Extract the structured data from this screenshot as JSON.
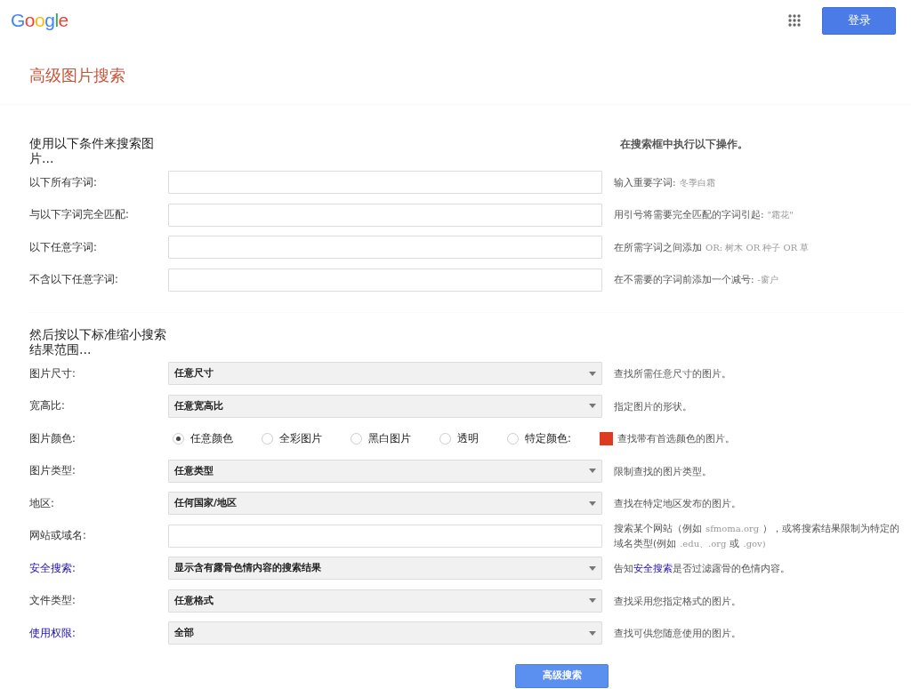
{
  "header": {
    "logo": "Google",
    "signin_button": "登录"
  },
  "page_title": "高级图片搜索",
  "sections": [
    {
      "heading": "使用以下条件来搜索图片...",
      "side_heading": "在搜索框中执行以下操作。",
      "rows": [
        {
          "kind": "input",
          "label": "以下所有字词:",
          "hint": [
            {
              "kind": "text",
              "text": "输入重要字词:"
            },
            {
              "kind": "example",
              "text": "冬季白霜"
            }
          ]
        },
        {
          "kind": "input",
          "label": "与以下字词完全匹配:",
          "hint": [
            {
              "kind": "text",
              "text": "用引号将需要完全匹配的字词引起:"
            },
            {
              "kind": "example",
              "text": "\"霜花\""
            }
          ]
        },
        {
          "kind": "input",
          "label": "以下任意字词:",
          "hint": [
            {
              "kind": "text",
              "text": "在所需字词之间添加"
            },
            {
              "kind": "example",
              "text": "OR: 树木 OR 种子 OR 草"
            }
          ]
        },
        {
          "kind": "input",
          "label": "不含以下任意字词:",
          "hint": [
            {
              "kind": "text",
              "text": "在不需要的字词前添加一个减号:"
            },
            {
              "kind": "example",
              "text": "-窗户"
            }
          ]
        }
      ]
    },
    {
      "heading": "然后按以下标准缩小搜索结果范围...",
      "rows": [
        {
          "kind": "select",
          "label": "图片尺寸:",
          "value": "任意尺寸",
          "hint": [
            {
              "kind": "text",
              "text": "查找所需任意尺寸的图片。"
            }
          ]
        },
        {
          "kind": "select",
          "label": "宽高比:",
          "value": "任意宽高比",
          "hint": [
            {
              "kind": "text",
              "text": "指定图片的形状。"
            }
          ]
        },
        {
          "kind": "radio",
          "label": "图片颜色:",
          "options": [
            {
              "label": "任意颜色",
              "selected": true
            },
            {
              "label": "全彩图片",
              "selected": false
            },
            {
              "label": "黑白图片",
              "selected": false
            },
            {
              "label": "透明",
              "selected": false
            },
            {
              "label": "特定颜色:",
              "selected": false
            }
          ],
          "color": "#dd3b20",
          "hint": [
            {
              "kind": "text",
              "text": "查找带有首选颜色的图片。"
            }
          ]
        },
        {
          "kind": "select",
          "label": "图片类型:",
          "value": "任意类型",
          "hint": [
            {
              "kind": "text",
              "text": "限制查找的图片类型。"
            }
          ]
        },
        {
          "kind": "select",
          "label": "地区:",
          "value": "任何国家/地区",
          "hint": [
            {
              "kind": "text",
              "text": "查找在特定地区发布的图片。"
            }
          ]
        },
        {
          "kind": "input",
          "label": "网站或域名:",
          "hint": [
            {
              "kind": "text",
              "text": "搜索某个网站（例如"
            },
            {
              "kind": "example",
              "text": "sfmoma.org"
            },
            {
              "kind": "text",
              "text": "），或将搜索结果限制为特定的域名类型(例如"
            },
            {
              "kind": "example",
              "text": ".edu、.org"
            },
            {
              "kind": "text",
              "text": "或"
            },
            {
              "kind": "example",
              "text": ".gov)"
            }
          ]
        },
        {
          "kind": "select",
          "label": "安全搜索:",
          "label_link": true,
          "value": "显示含有露骨色情内容的搜索结果",
          "hint": [
            {
              "kind": "text",
              "text": "告知"
            },
            {
              "kind": "link",
              "text": "安全搜索"
            },
            {
              "kind": "text",
              "text": "是否过滤露骨的色情内容。"
            }
          ]
        },
        {
          "kind": "select",
          "label": "文件类型:",
          "value": "任意格式",
          "hint": [
            {
              "kind": "text",
              "text": "查找采用您指定格式的图片。"
            }
          ]
        },
        {
          "kind": "select",
          "label": "使用权限:",
          "label_link": true,
          "value": "全部",
          "hint": [
            {
              "kind": "text",
              "text": "查找可供您随意使用的图片。"
            }
          ]
        }
      ]
    }
  ],
  "submit_button": "高级搜索"
}
